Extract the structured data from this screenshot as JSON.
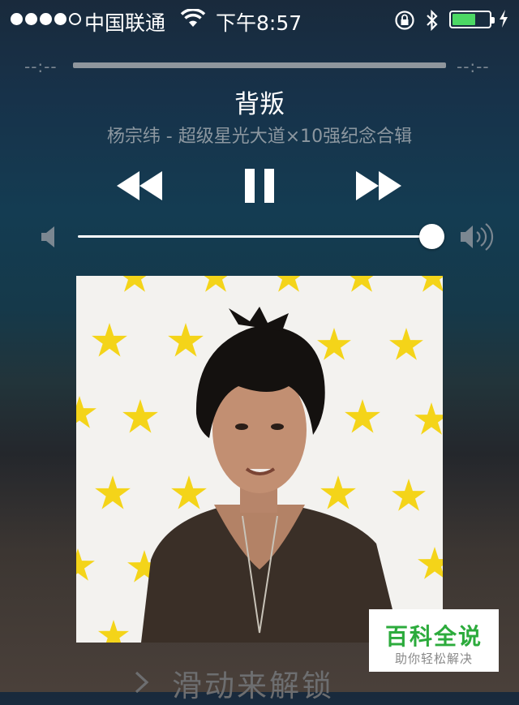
{
  "status_bar": {
    "signal_bars_filled": 4,
    "signal_bars_total": 5,
    "carrier": "中国联通",
    "time": "下午8:57",
    "battery_level": 0.64,
    "icons": [
      "wifi-icon",
      "rotation-lock-icon",
      "bluetooth-icon",
      "battery-icon",
      "charging-icon"
    ]
  },
  "player": {
    "elapsed": "--:--",
    "remaining": "--:--",
    "progress": 0,
    "title": "背叛",
    "subtitle": "杨宗纬 - 超级星光大道×10强纪念合辑",
    "state": "playing",
    "volume": 0.96
  },
  "lock_screen": {
    "slide_text": "滑动来解锁"
  },
  "watermark": {
    "title": "百科全说",
    "subtitle": "助你轻松解决"
  },
  "colors": {
    "battery_fill": "#4cd964",
    "watermark_green": "#2cab3c"
  }
}
